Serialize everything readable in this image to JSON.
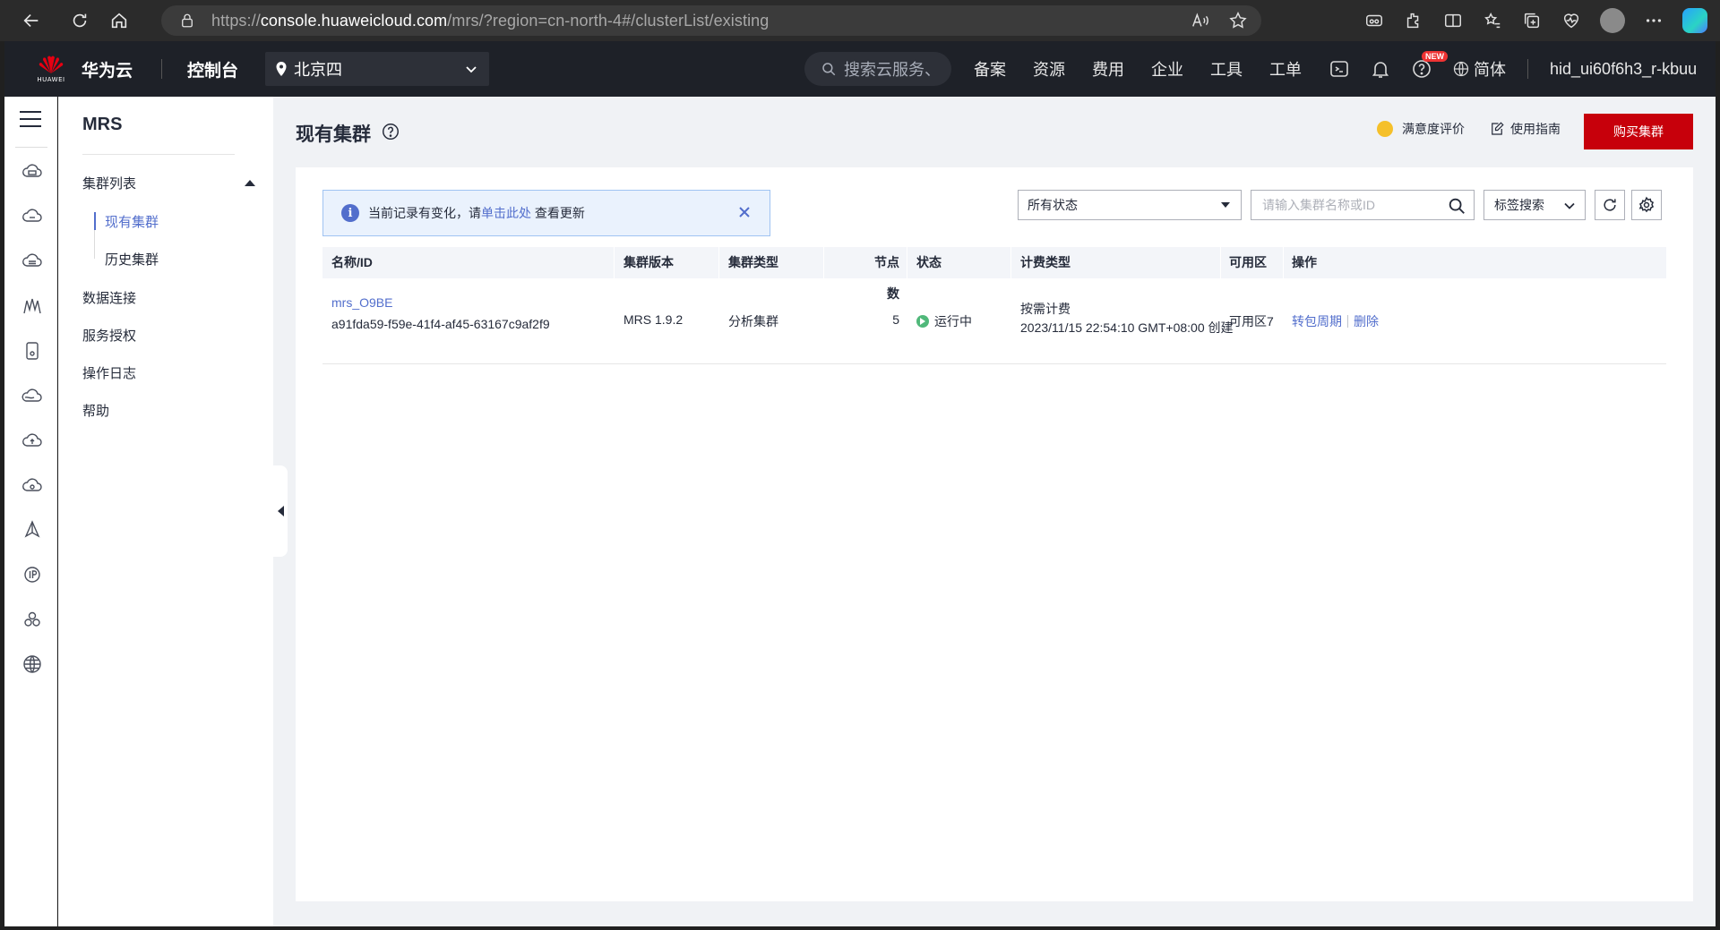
{
  "browser": {
    "url_prefix": "https://",
    "url_host": "console.huaweicloud.com",
    "url_path": "/mrs/?region=cn-north-4#/clusterList/existing"
  },
  "header": {
    "brand_logo_text": "HUAWEI",
    "brand_name": "华为云",
    "console_label": "控制台",
    "region": "北京四",
    "search_placeholder": "搜索云服务、",
    "nav": [
      "备案",
      "资源",
      "费用",
      "企业",
      "工具",
      "工单"
    ],
    "new_badge": "NEW",
    "language": "简体",
    "username": "hid_ui60f6h3_r-kbuu"
  },
  "sidebar": {
    "service_title": "MRS",
    "cluster_list_label": "集群列表",
    "existing_clusters_label": "现有集群",
    "history_clusters_label": "历史集群",
    "data_connection_label": "数据连接",
    "service_auth_label": "服务授权",
    "operation_log_label": "操作日志",
    "help_label": "帮助"
  },
  "page": {
    "title": "现有集群",
    "rate_label": "满意度评价",
    "guide_label": "使用指南",
    "buy_button": "购买集群"
  },
  "notice": {
    "text_before": "当前记录有变化，请",
    "link_text": "单击此处",
    "text_after": "查看更新"
  },
  "filters": {
    "status_value": "所有状态",
    "search_placeholder": "请输入集群名称或ID",
    "tag_search_label": "标签搜索"
  },
  "table": {
    "columns": {
      "name": "名称/ID",
      "version": "集群版本",
      "type": "集群类型",
      "nodes": "节点数",
      "status": "状态",
      "billing": "计费类型",
      "az": "可用区",
      "ops": "操作"
    },
    "rows": [
      {
        "name": "mrs_O9BE",
        "id": "a91fda59-f59e-41f4-af45-63167c9af2f9",
        "version": "MRS 1.9.2",
        "type": "分析集群",
        "nodes": "5",
        "status": "运行中",
        "billing": "按需计费",
        "created": "2023/11/15 22:54:10 GMT+08:00 创建",
        "az": "可用区7",
        "op_convert": "转包周期",
        "op_delete": "删除"
      }
    ]
  },
  "colors": {
    "brand_red": "#c7000b",
    "link_blue": "#526ecc",
    "running_green": "#50b87a",
    "header_dark": "#1e2128"
  }
}
